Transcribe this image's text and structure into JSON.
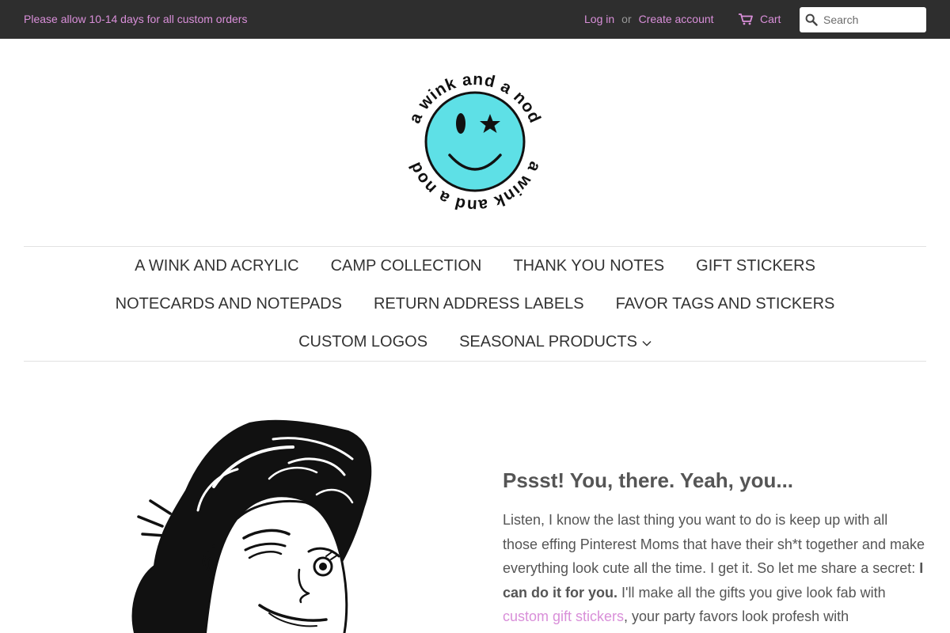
{
  "topbar": {
    "announcement": "Please allow 10-14 days for all custom orders",
    "login_label": "Log in",
    "or_label": "or",
    "create_account_label": "Create account",
    "cart_label": "Cart",
    "search_placeholder": "Search"
  },
  "logo": {
    "text_top": "a wink and a nod",
    "text_bottom": "a wink and a nod",
    "face_color": "#5ee0e6"
  },
  "nav": {
    "rows": [
      [
        "A WINK AND ACRYLIC",
        "CAMP COLLECTION",
        "THANK YOU NOTES",
        "GIFT STICKERS"
      ],
      [
        "NOTECARDS AND NOTEPADS",
        "RETURN ADDRESS LABELS",
        "FAVOR TAGS AND STICKERS"
      ],
      [
        "CUSTOM LOGOS",
        "SEASONAL PRODUCTS"
      ]
    ]
  },
  "intro": {
    "heading": "Pssst! You, there. Yeah, you...",
    "p_start": "Listen, I know the last thing you want to do is keep up with all those effing Pinterest Moms that have their sh*t together and make everything look cute all the time. I get it. So let me share a secret: ",
    "p_bold": "I can do it for you.",
    "p_mid": " I'll make all the gifts you give look fab with ",
    "p_link": "custom gift stickers",
    "p_end": ", your party favors look profesh with"
  },
  "colors": {
    "topbar_bg": "#2e2e2e",
    "link_accent": "#d98fd9",
    "body_text": "#555555",
    "nav_text": "#333333"
  },
  "icons": {
    "cart": "cart-icon",
    "search": "search-icon",
    "dropdown": "chevron-down-icon"
  }
}
